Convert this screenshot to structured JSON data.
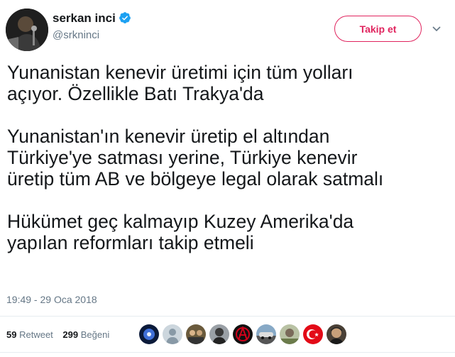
{
  "user": {
    "display_name": "serkan inci",
    "handle": "@srkninci",
    "verified": true
  },
  "follow_button": {
    "label": "Takip et",
    "color": "#e0245e"
  },
  "tweet": {
    "paragraphs": [
      [
        "Yunanistan kenevir üretimi için tüm yolları",
        "açıyor. Özellikle Batı Trakya'da"
      ],
      [
        "Yunanistan'ın kenevir üretip el altından",
        "Türkiye'ye satması yerine, Türkiye kenevir",
        "üretip tüm AB ve bölgeye legal olarak satmalı"
      ],
      [
        "Hükümet geç kalmayıp Kuzey Amerika'da",
        "yapılan reformları takip etmeli"
      ]
    ],
    "timestamp": "19:49 - 29 Oca 2018"
  },
  "stats": {
    "retweets": {
      "count": "59",
      "label": "Retweet"
    },
    "likes": {
      "count": "299",
      "label": "Beğeni"
    }
  },
  "likers": [
    {
      "icon": "galaxy-avatar"
    },
    {
      "icon": "default-user-avatar"
    },
    {
      "icon": "group-photo-avatar"
    },
    {
      "icon": "person-avatar"
    },
    {
      "icon": "anarchy-symbol-avatar"
    },
    {
      "icon": "car-avatar"
    },
    {
      "icon": "outdoor-avatar"
    },
    {
      "icon": "turkish-flag-avatar"
    },
    {
      "icon": "man-face-avatar"
    }
  ]
}
